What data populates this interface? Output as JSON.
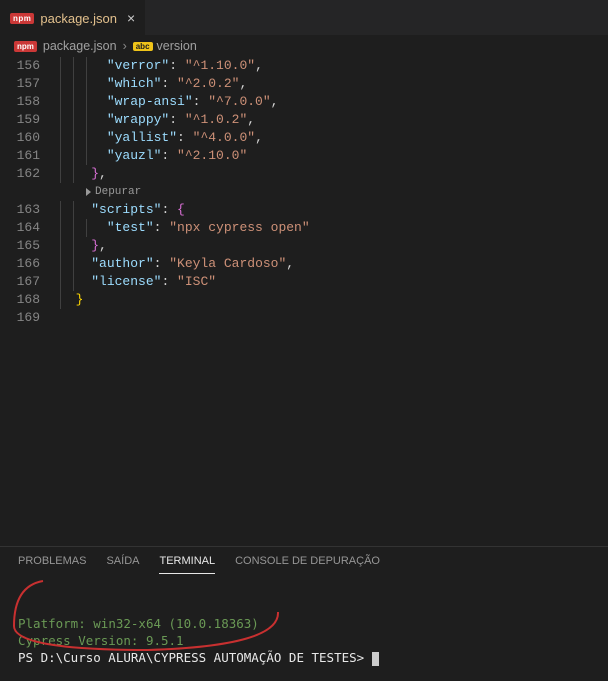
{
  "tab": {
    "filename": "package.json",
    "icon": "npm"
  },
  "breadcrumb": {
    "file": "package.json",
    "symbol": "version"
  },
  "gutter": {
    "lines": [
      "156",
      "157",
      "158",
      "159",
      "160",
      "161",
      "162",
      "",
      "163",
      "164",
      "165",
      "166",
      "167",
      "168",
      "169"
    ]
  },
  "code": {
    "deps": [
      {
        "key": "verror",
        "val": "^1.10.0"
      },
      {
        "key": "which",
        "val": "^2.0.2"
      },
      {
        "key": "wrap-ansi",
        "val": "^7.0.0"
      },
      {
        "key": "wrappy",
        "val": "^1.0.2"
      },
      {
        "key": "yallist",
        "val": "^4.0.0"
      },
      {
        "key": "yauzl",
        "val": "^2.10.0"
      }
    ],
    "codelens": "Depurar",
    "scripts_key": "scripts",
    "test_key": "test",
    "test_val": "npx cypress open",
    "author_key": "author",
    "author_val": "Keyla Cardoso",
    "license_key": "license",
    "license_val": "ISC"
  },
  "panel": {
    "tabs": [
      "PROBLEMAS",
      "SAÍDA",
      "TERMINAL",
      "CONSOLE DE DEPURAÇÃO"
    ],
    "active": 2
  },
  "terminal": {
    "platform_label": "Platform: ",
    "platform_value": "win32-x64 (10.0.18363)",
    "cypress_label": "Cypress Version: ",
    "cypress_value": "9.5.1",
    "prompt_prefix": "PS ",
    "prompt_path": "D:\\Curso ALURA\\CYPRESS AUTOMAÇÃO DE TESTES",
    "prompt_suffix": "> "
  }
}
